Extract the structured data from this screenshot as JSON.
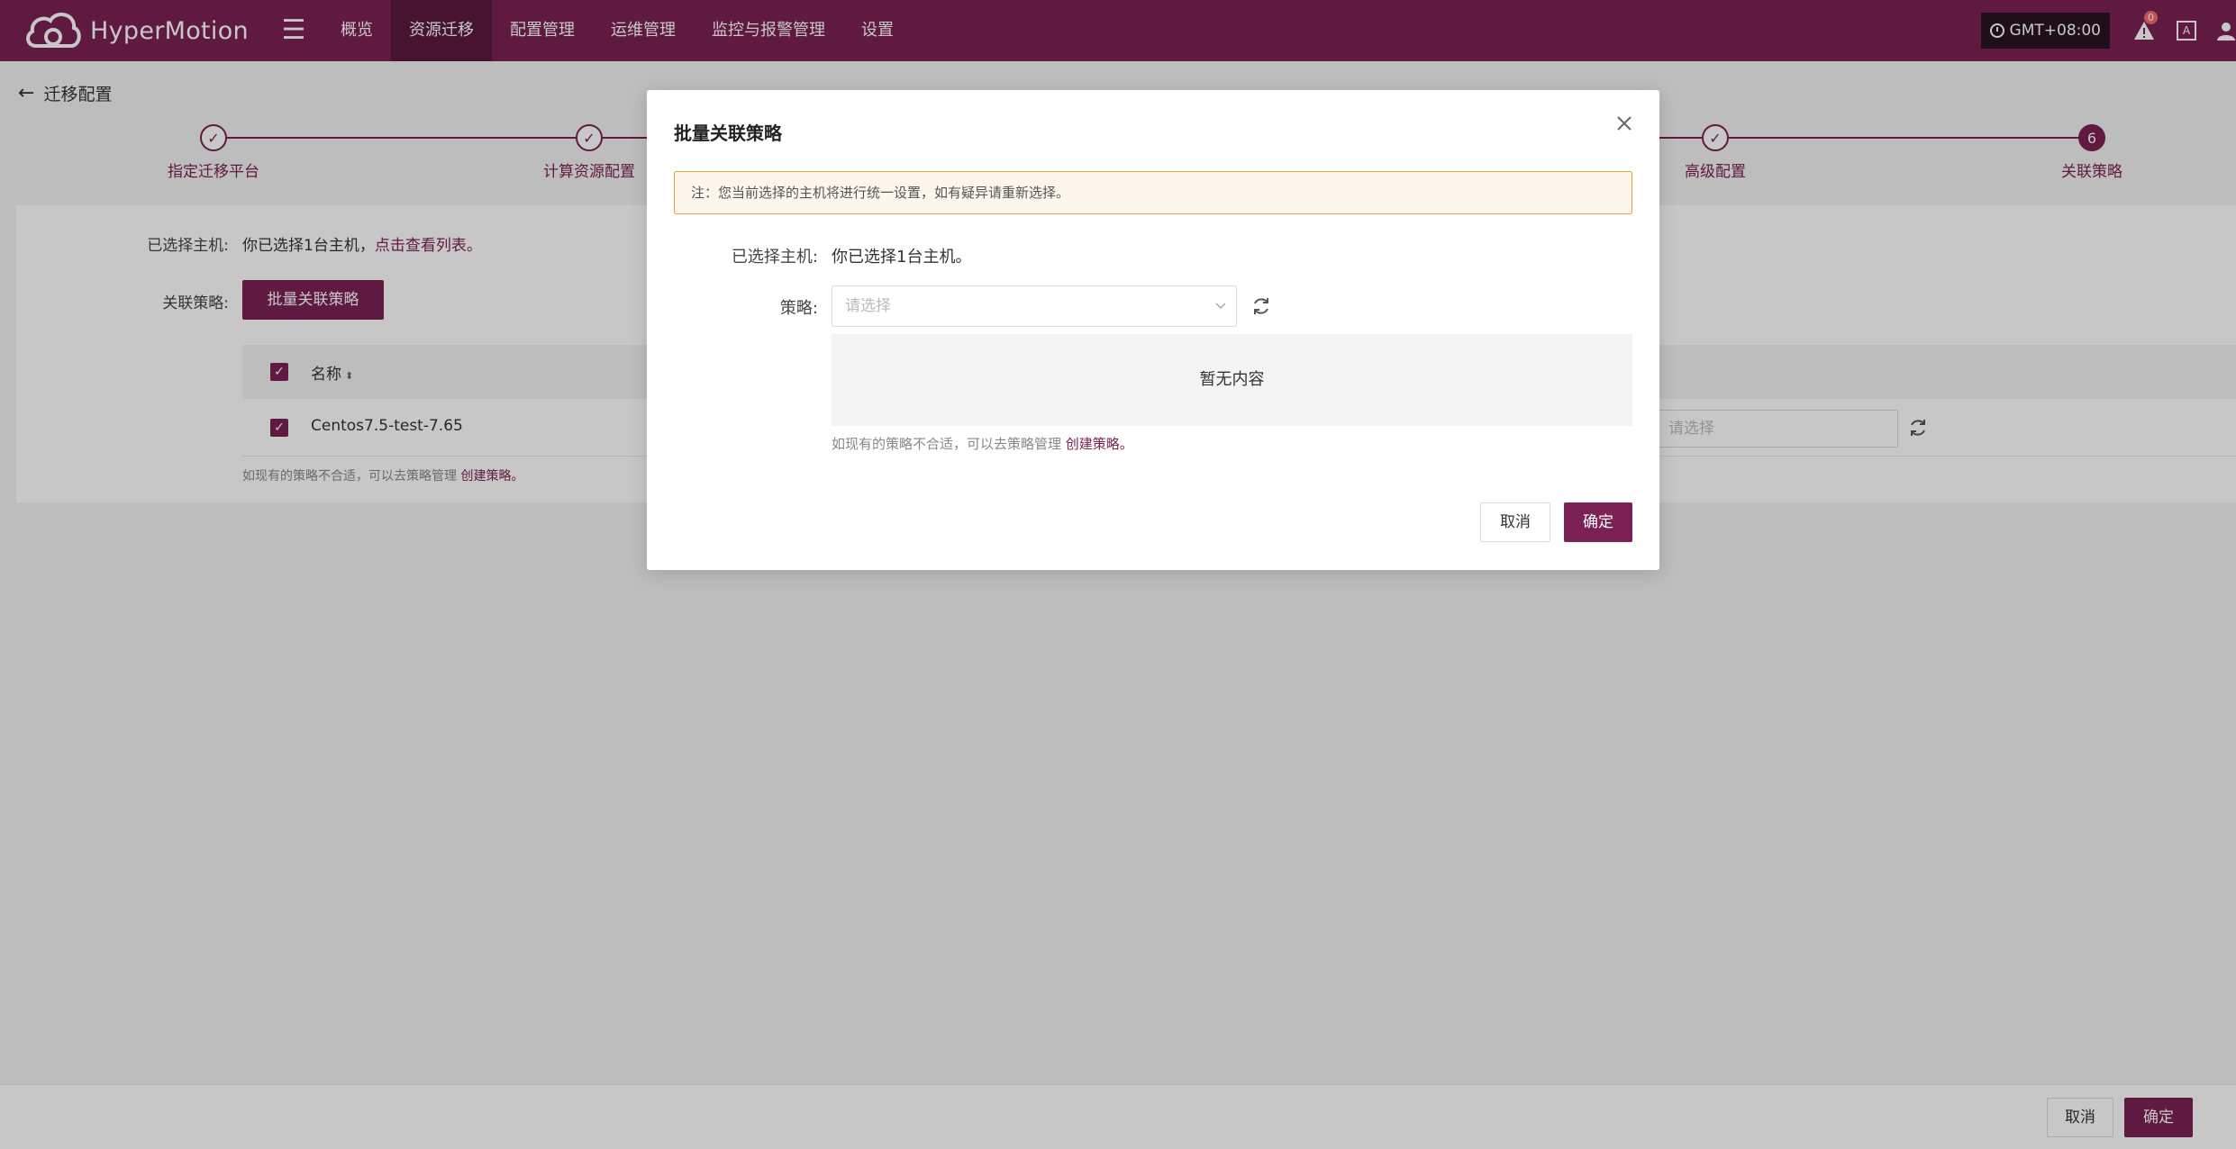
{
  "app": {
    "name": "HyperMotion"
  },
  "nav": {
    "items": [
      {
        "label": "概览",
        "active": false
      },
      {
        "label": "资源迁移",
        "active": true
      },
      {
        "label": "配置管理",
        "active": false
      },
      {
        "label": "运维管理",
        "active": false
      },
      {
        "label": "监控与报警管理",
        "active": false
      },
      {
        "label": "设置",
        "active": false
      }
    ],
    "timezone": "GMT+08:00",
    "alert_count": "0",
    "lang_icon_label": "A"
  },
  "page": {
    "title": "迁移配置",
    "steps": [
      {
        "label": "指定迁移平台",
        "state": "done",
        "num": ""
      },
      {
        "label": "计算资源配置",
        "state": "done",
        "num": ""
      },
      {
        "label": "高级配置",
        "state": "done",
        "num": ""
      },
      {
        "label": "关联策略",
        "state": "current",
        "num": "6"
      }
    ],
    "selected_hosts_label": "已选择主机:",
    "selected_hosts_text": "你已选择1台主机，",
    "selected_hosts_link": "点击查看列表。",
    "policy_label": "关联策略:",
    "batch_button": "批量关联策略",
    "table": {
      "header_name": "名称",
      "rows": [
        {
          "name": "Centos7.5-test-7.65",
          "policy_placeholder": "请选择"
        }
      ]
    },
    "hint_text": "如现有的策略不合适，可以去策略管理 ",
    "hint_link": "创建策略。"
  },
  "footer": {
    "cancel": "取消",
    "confirm": "确定"
  },
  "modal": {
    "title": "批量关联策略",
    "notice": "注：您当前选择的主机将进行统一设置，如有疑异请重新选择。",
    "selected_label": "已选择主机:",
    "selected_text": "你已选择1台主机。",
    "policy_label": "策略:",
    "policy_placeholder": "请选择",
    "empty_text": "暂无内容",
    "hint_text": "如现有的策略不合适，可以去策略管理 ",
    "hint_link": "创建策略。",
    "cancel": "取消",
    "confirm": "确定"
  },
  "colors": {
    "brand": "#7c2153",
    "brand_dark": "#5c1a3e",
    "warning_border": "#e6a23c",
    "warning_bg": "#fdf6ec"
  }
}
